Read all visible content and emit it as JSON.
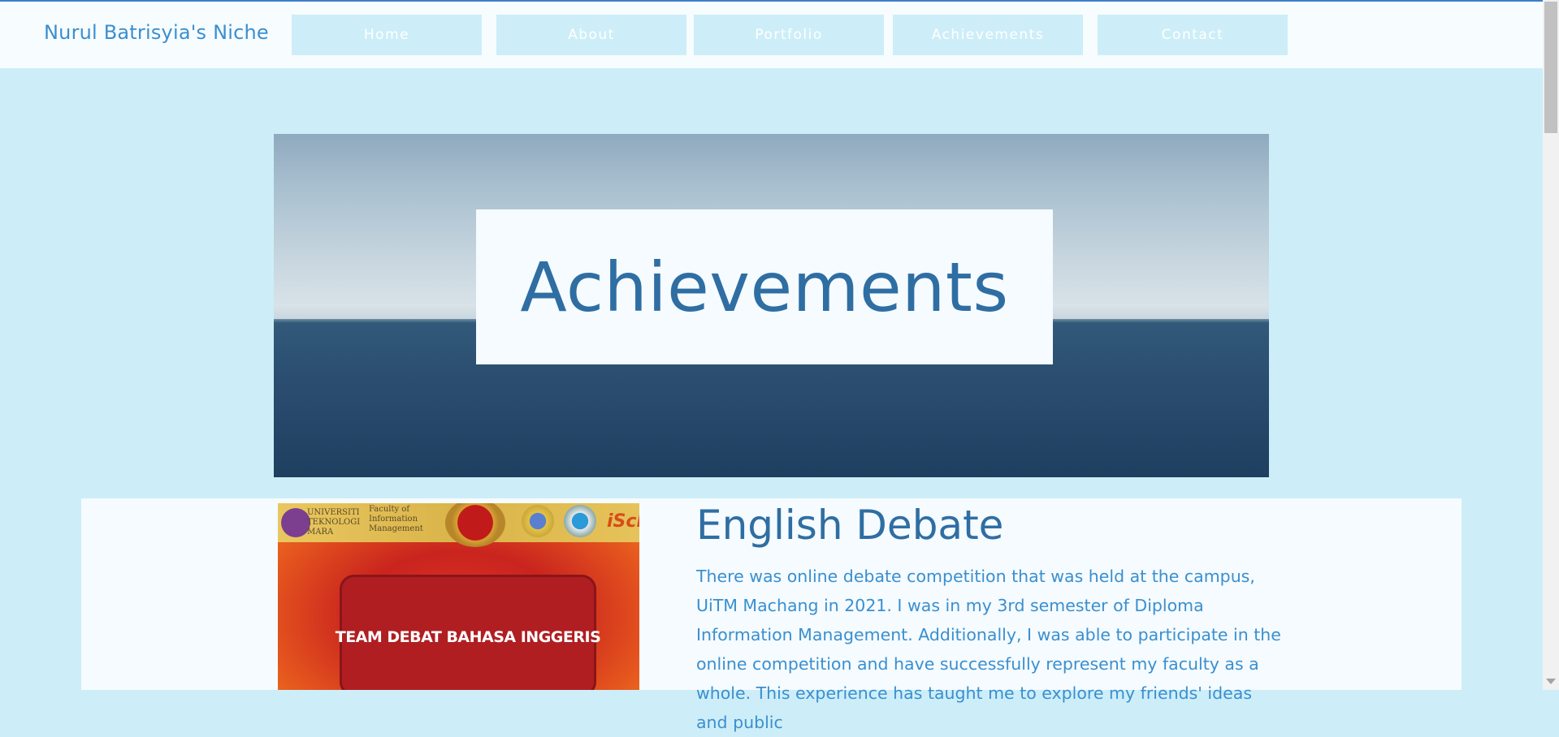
{
  "header": {
    "site_title": "Nurul Batrisyia's Niche",
    "nav": [
      "Home",
      "About",
      "Portfolio",
      "Achievements",
      "Contact"
    ]
  },
  "hero": {
    "title": "Achievements"
  },
  "section": {
    "image": {
      "university_text": "UNIVERSITI\nTEKNOLOGI\nMARA",
      "faculty_text": "Faculty of\nInformation\nManagement",
      "brand_text": "iSch",
      "plaque_text": "TEAM DEBAT BAHASA INGGERIS"
    },
    "heading": "English Debate",
    "body": "There was online debate competition that was held at the campus, UiTM Machang in 2021. I was in my 3rd semester of Diploma Information Management. Additionally, I was able to participate in the online competition and have successfully represent my faculty as a whole. This experience has taught me to explore my friends' ideas and public"
  },
  "colors": {
    "page_background": "#cdeef8",
    "header_background": "#f7fcfe",
    "accent": "#3a8fd0",
    "heading": "#2f6ea3"
  }
}
